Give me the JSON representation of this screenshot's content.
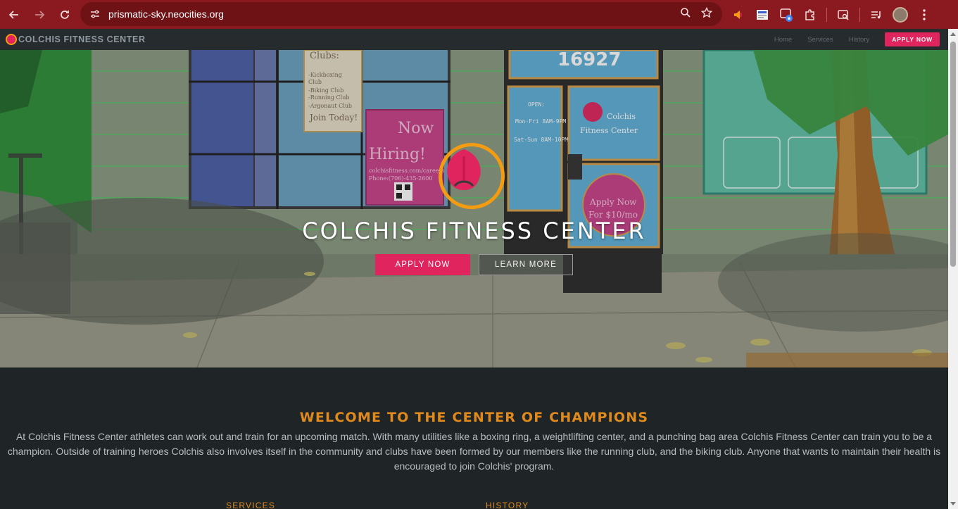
{
  "browser": {
    "url": "prismatic-sky.neocities.org",
    "icons": [
      "back-icon",
      "forward-icon",
      "reload-icon",
      "site-settings-icon",
      "zoom-icon",
      "bookmark-star-icon",
      "extension-icons",
      "profile-avatar",
      "menu-icon"
    ]
  },
  "site": {
    "brand": "COLCHIS FITNESS CENTER",
    "nav": {
      "home": "Home",
      "services": "Services",
      "history": "History",
      "apply": "APPLY NOW"
    }
  },
  "hero": {
    "title": "COLCHIS FITNESS CENTER",
    "apply_button": "APPLY NOW",
    "learn_button": "LEARN MORE"
  },
  "welcome": {
    "title": "WELCOME TO THE CENTER OF CHAMPIONS",
    "text": "At Colchis Fitness Center athletes can work out and train for an upcoming match. With many utilities like a boxing ring, a weightlifting center, and a punching bag area Colchis Fitness Center can train you to be a champion. Outside of training heroes Colchis also involves itself in the community and clubs have been formed by our members like the running club, and the biking club. Anyone that wants to maintain their health is encouraged to join Colchis' program."
  },
  "sections": {
    "services": "SERVICES",
    "history": "HISTORY"
  },
  "colors": {
    "accent": "#e0245e",
    "orange": "#e08a1e",
    "chrome": "#8a1a1f",
    "background": "#1f2426"
  }
}
